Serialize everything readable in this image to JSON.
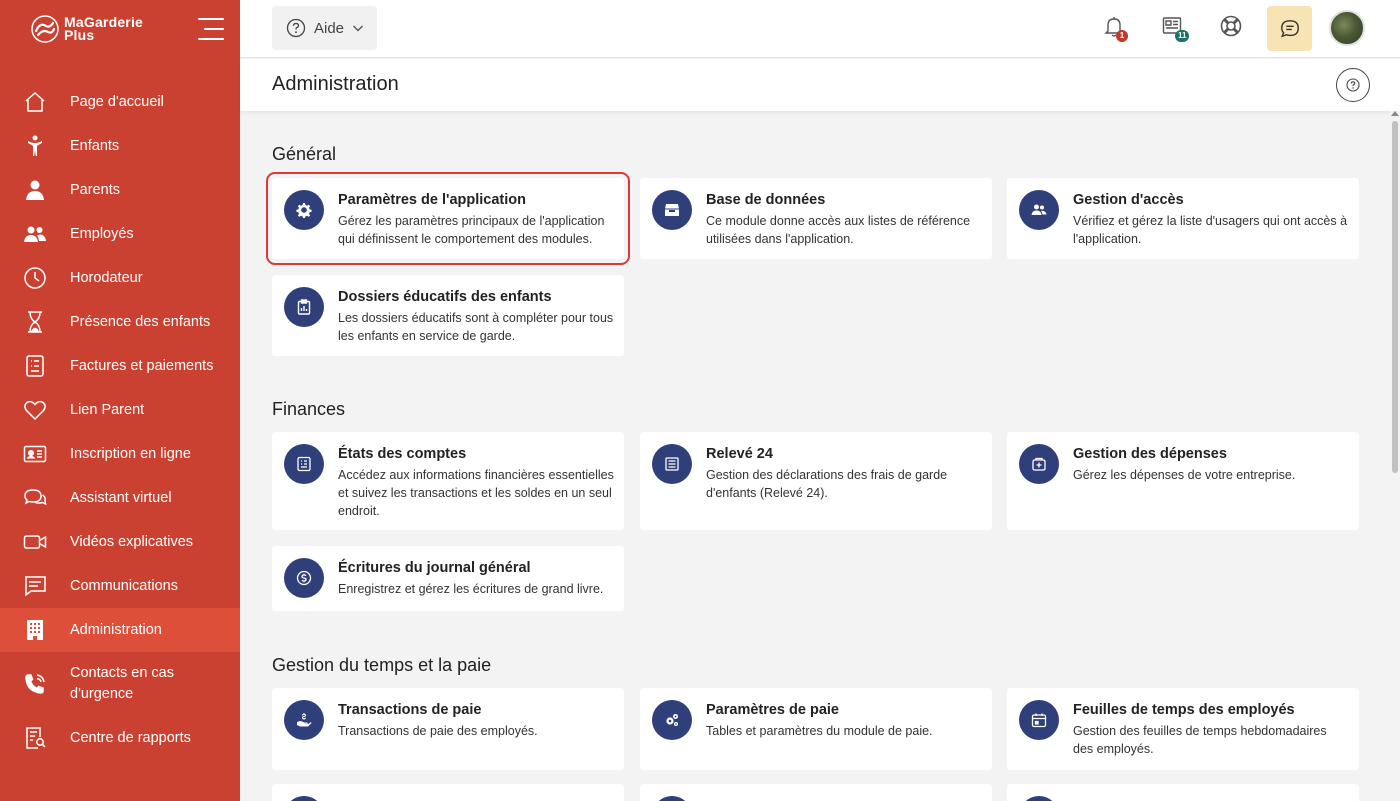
{
  "app": {
    "logo_line1": "MaGarderie",
    "logo_line2": "Plus"
  },
  "colors": {
    "sidebar": "#cb4131",
    "sidebar_active": "#de4f3a",
    "card_icon_bg": "#2f3f7a",
    "notif_badge": "#c0392b",
    "news_badge": "#1f6f6a",
    "chat_bg": "#f7e3b3"
  },
  "sidebar": {
    "items": [
      {
        "label": "Page d'accueil",
        "icon": "home-icon"
      },
      {
        "label": "Enfants",
        "icon": "child-icon"
      },
      {
        "label": "Parents",
        "icon": "parent-icon"
      },
      {
        "label": "Employés",
        "icon": "employees-icon"
      },
      {
        "label": "Horodateur",
        "icon": "clock-icon"
      },
      {
        "label": "Présence des enfants",
        "icon": "hourglass-icon"
      },
      {
        "label": "Factures et paiements",
        "icon": "invoice-icon"
      },
      {
        "label": "Lien Parent",
        "icon": "heart-icon"
      },
      {
        "label": "Inscription en ligne",
        "icon": "id-card-icon"
      },
      {
        "label": "Assistant virtuel",
        "icon": "chat-bubbles-icon"
      },
      {
        "label": "Vidéos explicatives",
        "icon": "video-icon"
      },
      {
        "label": "Communications",
        "icon": "message-icon"
      },
      {
        "label": "Administration",
        "icon": "building-icon",
        "active": true
      },
      {
        "label": "Contacts en cas d'urgence",
        "icon": "phone-icon"
      },
      {
        "label": "Centre de rapports",
        "icon": "report-icon"
      }
    ]
  },
  "topbar": {
    "help_label": "Aide",
    "notifications_count": "1",
    "news_count": "11"
  },
  "page": {
    "title": "Administration"
  },
  "sections": {
    "general": {
      "title": "Général",
      "cards": [
        {
          "title": "Paramètres de l'application",
          "desc": "Gérez les paramètres principaux de l'application qui définissent le comportement des modules.",
          "icon": "gear-icon"
        },
        {
          "title": "Base de données",
          "desc": "Ce module donne accès aux listes de référence utilisées dans l'application.",
          "icon": "archive-icon"
        },
        {
          "title": "Gestion d'accès",
          "desc": "Vérifiez et gérez la liste d'usagers qui ont accès à l'application.",
          "icon": "users-icon"
        },
        {
          "title": "Dossiers éducatifs des enfants",
          "desc": "Les dossiers éducatifs sont à compléter pour tous les enfants en service de garde.",
          "icon": "clipboard-icon"
        }
      ]
    },
    "finances": {
      "title": "Finances",
      "cards": [
        {
          "title": "États des comptes",
          "desc": "Accédez aux informations financières essentielles et suivez les transactions et les soldes en un seul endroit.",
          "icon": "statement-icon"
        },
        {
          "title": "Relevé 24",
          "desc": "Gestion des déclarations des frais de garde d'enfants (Relevé 24).",
          "icon": "document-icon"
        },
        {
          "title": "Gestion des dépenses",
          "desc": "Gérez les dépenses de votre entreprise.",
          "icon": "wallet-icon"
        },
        {
          "title": "Écritures du journal général",
          "desc": "Enregistrez et gérez les écritures de grand livre.",
          "icon": "coin-icon"
        }
      ]
    },
    "payroll": {
      "title": "Gestion du temps et la paie",
      "cards": [
        {
          "title": "Transactions de paie",
          "desc": "Transactions de paie des employés.",
          "icon": "hand-money-icon"
        },
        {
          "title": "Paramètres de paie",
          "desc": "Tables et paramètres du module de paie.",
          "icon": "cogs-icon"
        },
        {
          "title": "Feuilles de temps des employés",
          "desc": "Gestion des feuilles de temps hebdomadaires des employés.",
          "icon": "calendar-icon"
        }
      ]
    }
  }
}
